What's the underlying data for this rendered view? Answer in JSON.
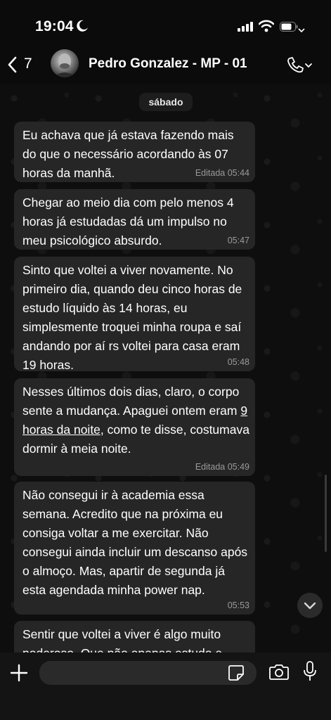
{
  "status": {
    "time": "19:04"
  },
  "header": {
    "back_count": "7",
    "contact_name": "Pedro Gonzalez - MP - 01"
  },
  "chat": {
    "date_label": "sábado",
    "messages": [
      {
        "text": "Eu achava que já estava fazendo mais do que o necessário acordando às 07 horas da manhã.",
        "time": "Editada 05:44"
      },
      {
        "text": "Chegar ao meio dia com pelo menos 4 horas já estudadas dá um impulso no meu psicológico absurdo.",
        "time": "05:47"
      },
      {
        "text": "Sinto que voltei a viver novamente. No primeiro dia, quando deu cinco horas de estudo líquido às 14 horas, eu simplesmente troquei minha roupa e saí andando por aí rs voltei para casa eram 19 horas.",
        "time": "05:48"
      },
      {
        "text_before": "Nesses últimos dois dias, claro, o corpo sente a mudança. Apaguei ontem eram ",
        "link": "9 horas da noite",
        "text_after": ", como te disse, costumava dormir à meia noite.",
        "time": "Editada 05:49"
      },
      {
        "text": "Não consegui ir à academia essa semana. Acredito que na próxima eu consiga voltar a me exercitar. Não consegui ainda incluir um descanso após o almoço. Mas, apartir de segunda já esta agendada minha power nap.",
        "time": "05:53"
      },
      {
        "text": "Sentir que voltei a viver é algo muito poderoso. Que não apenas estudo e"
      }
    ]
  },
  "input": {
    "placeholder": ""
  },
  "icons": [
    "moon-icon",
    "signal-icon",
    "wifi-icon",
    "battery-icon",
    "chevron-down-icon",
    "back-icon",
    "avatar",
    "phone-icon",
    "scroll-down-icon",
    "plus-icon",
    "sticker-icon",
    "camera-icon",
    "mic-icon"
  ]
}
